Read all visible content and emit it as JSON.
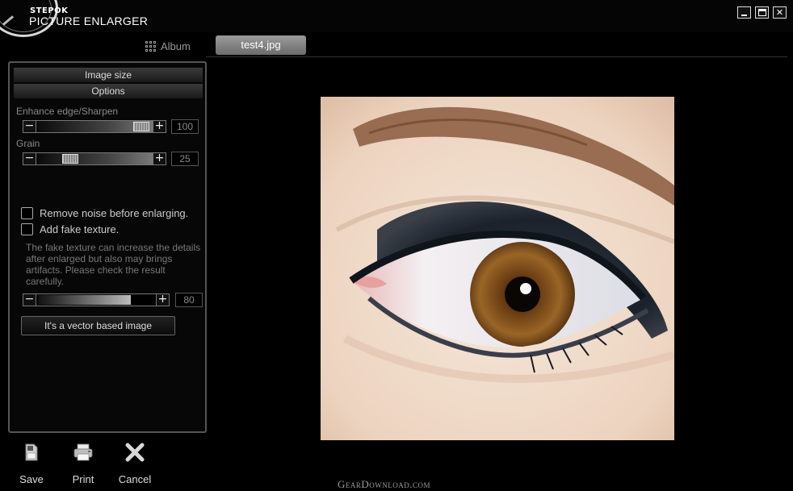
{
  "app": {
    "logo_small": "STEPOK",
    "logo_big": "PICTURE ENLARGER"
  },
  "window_controls": {
    "close_glyph": "✕"
  },
  "tabs": {
    "album_label": "Album",
    "file_label": "test4.jpg"
  },
  "panel": {
    "image_size_header": "Image size",
    "options_header": "Options",
    "sharpen": {
      "label": "Enhance edge/Sharpen",
      "value": "100",
      "fraction": 1.0
    },
    "grain": {
      "label": "Grain",
      "value": "25",
      "fraction": 0.25
    },
    "remove_noise_label": "Remove noise before enlarging.",
    "fake_texture_label": "Add fake texture.",
    "fake_texture_description": "The fake texture can increase the details after enlarged but also may brings artifacts. Please check the result carefully.",
    "texture": {
      "value": "80",
      "fraction": 0.8
    },
    "vector_button_label": "It's a vector based image"
  },
  "actions": {
    "save_label": "Save",
    "print_label": "Print",
    "cancel_label": "Cancel"
  },
  "watermark": "GearDownload.com",
  "colors": {
    "background": "#000000",
    "panel_border": "#555555",
    "active_tab": "#8a8a8a",
    "iris": "#8a5520",
    "eyeshadow": "#1e2630",
    "skin": "#f1dfd0"
  }
}
